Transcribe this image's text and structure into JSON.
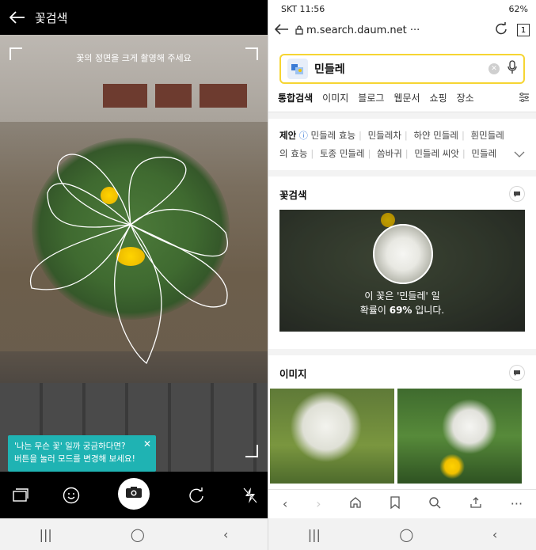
{
  "left": {
    "title": "꽃검색",
    "hint": "꽃의 정면을 크게 촬영해 주세요",
    "tooltip": {
      "line1": "'나는 무슨 꽃' 일까 궁금하다면?",
      "line2": "버튼을 눌러 모드를 변경해 보세요!"
    },
    "icons": [
      "back-arrow-icon",
      "gallery-icon",
      "smile-icon",
      "camera-icon",
      "rotate-icon",
      "flash-off-icon"
    ]
  },
  "right": {
    "status": {
      "carrier_time": "SKT 11:56",
      "battery": "62%"
    },
    "url": "m.search.daum.net ···",
    "tab_count": "1",
    "query": "민들레",
    "tabs": [
      "통합검색",
      "이미지",
      "블로그",
      "웹문서",
      "쇼핑",
      "장소"
    ],
    "suggest": {
      "label": "제안",
      "row1": [
        "민들레 효능",
        "민들레차",
        "하얀 민들레",
        "흰민들레"
      ],
      "row2": [
        "의 효능",
        "토종 민들레",
        "씀바귀",
        "민들레 씨앗",
        "민들레"
      ]
    },
    "flower_search": {
      "title": "꽃검색",
      "line1": "이 꽃은 '민들레' 일",
      "line2_prefix": "확률이 ",
      "percent": "69%",
      "line2_suffix": " 입니다."
    },
    "images_title": "이미지"
  },
  "colors": {
    "accent_yellow": "#f6d533",
    "tooltip_teal": "#1fb3b3"
  }
}
